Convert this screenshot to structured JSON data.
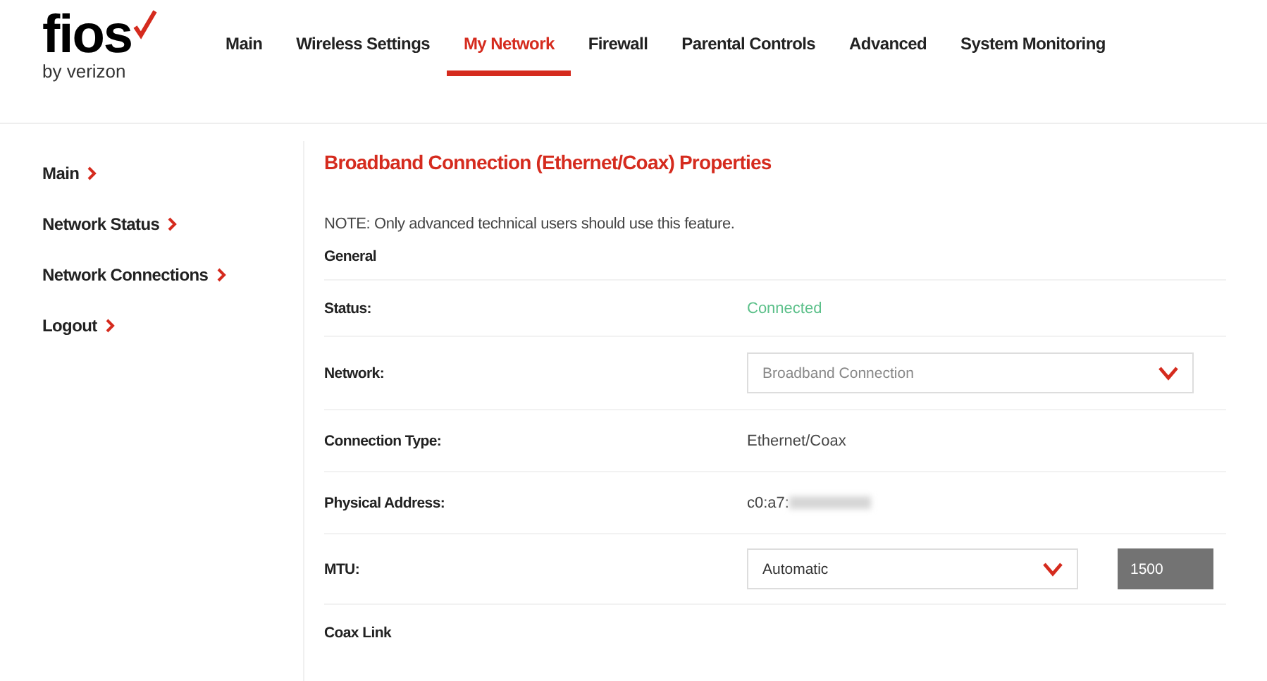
{
  "logo": {
    "wordmark": "fios",
    "tagline": "by verizon"
  },
  "nav": [
    {
      "label": "Main",
      "selected": false
    },
    {
      "label": "Wireless Settings",
      "selected": false
    },
    {
      "label": "My Network",
      "selected": true
    },
    {
      "label": "Firewall",
      "selected": false
    },
    {
      "label": "Parental Controls",
      "selected": false
    },
    {
      "label": "Advanced",
      "selected": false
    },
    {
      "label": "System Monitoring",
      "selected": false
    }
  ],
  "sidebar": {
    "items": [
      "Main",
      "Network Status",
      "Network Connections",
      "Logout"
    ]
  },
  "panel": {
    "title": "Broadband Connection (Ethernet/Coax) Properties",
    "note": "NOTE: Only advanced technical users should use this feature.",
    "rows": [
      {
        "kind": "section",
        "label": "General"
      },
      {
        "kind": "status",
        "label": "Status:",
        "value": "Connected"
      },
      {
        "kind": "select",
        "label": "Network:",
        "value": "Broadband Connection"
      },
      {
        "kind": "text",
        "label": "Connection Type:",
        "value": "Ethernet/Coax"
      },
      {
        "kind": "redacted",
        "label": "Physical Address:",
        "value": "c0:a7:"
      },
      {
        "kind": "select-field",
        "label": "MTU:",
        "value": "Automatic",
        "field": "1500",
        "disabled": true
      },
      {
        "kind": "section",
        "label": "Coax Link"
      }
    ]
  }
}
